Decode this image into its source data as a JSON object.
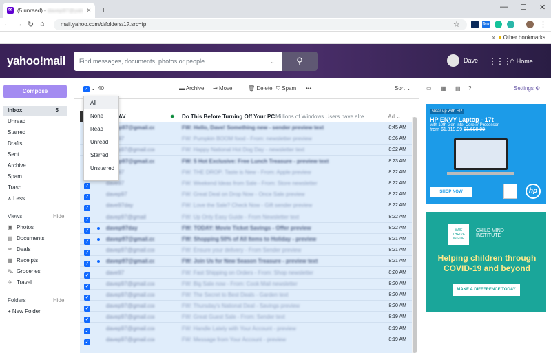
{
  "browser": {
    "tab_title": "(5 unread) - ",
    "tab_blur": "davep97@yahoo.com",
    "url": "mail.yahoo.com/d/folders/1?.src=fp",
    "bookmarks": "Other bookmarks",
    "ext_new": "New"
  },
  "header": {
    "logo": "yahoo!mail",
    "search_placeholder": "Find messages, documents, photos or people",
    "user": "Dave",
    "home": "Home"
  },
  "sidebar": {
    "compose": "Compose",
    "folders": [
      {
        "label": "Inbox",
        "count": "5"
      },
      {
        "label": "Unread"
      },
      {
        "label": "Starred"
      },
      {
        "label": "Drafts"
      },
      {
        "label": "Sent"
      },
      {
        "label": "Archive"
      },
      {
        "label": "Spam"
      },
      {
        "label": "Trash"
      },
      {
        "label": "∧ Less"
      }
    ],
    "views_label": "Views",
    "views_hide": "Hide",
    "views": [
      "Photos",
      "Documents",
      "Deals",
      "Receipts",
      "Groceries",
      "Travel"
    ],
    "folders_label": "Folders",
    "folders_hide": "Hide",
    "new_folder": "+ New Folder"
  },
  "toolbar": {
    "count": "40",
    "archive": "Archive",
    "move": "Move",
    "delete": "Delete",
    "spam": "Spam",
    "more": "•••",
    "sort": "Sort"
  },
  "select_menu": [
    "All",
    "None",
    "Read",
    "Unread",
    "Starred",
    "Unstarred"
  ],
  "ad_row": {
    "sender": "AV",
    "subject": "Do This Before Turning Off Your PC",
    "preview": "Millions of Windows Users have alre...",
    "tag": "Ad"
  },
  "rows": [
    {
      "sender": "davep97@gmail.com",
      "subject": "FW: Hello, Dave! Something new - sender preview text",
      "time": "8:45 AM",
      "bold": true
    },
    {
      "sender": "dave97",
      "subject": "FW: Pumpkin BOOM food - From: newsletter preview",
      "time": "8:36 AM",
      "bold": false
    },
    {
      "sender": "davep97@gmail.com",
      "subject": "FW: Happy National Hot Dog Day - newsletter text",
      "time": "8:32 AM",
      "bold": false
    },
    {
      "sender": "davep97@gmail.com",
      "subject": "FW: 5 Hot Exclusive: Free Lunch Treasure - preview text",
      "time": "8:23 AM",
      "bold": true
    },
    {
      "sender": "dave97",
      "subject": "FW: THE DROP: Taste is New - From: Apple preview",
      "time": "8:22 AM",
      "bold": false
    },
    {
      "sender": "dave97",
      "subject": "FW: Weekend Ideas from Sale - From: Store newsletter",
      "time": "8:22 AM",
      "bold": false
    },
    {
      "sender": "davep97",
      "subject": "FW: Great Deal on Drop Now - Once Sale preview",
      "time": "8:22 AM",
      "bold": false
    },
    {
      "sender": "dave97day",
      "subject": "FW: Love the Sale? Check Now - Gift sender preview",
      "time": "8:22 AM",
      "bold": false
    },
    {
      "sender": "davep97@gmail",
      "subject": "FW: Up Only Easy Guide - From Newsletter text",
      "time": "8:22 AM",
      "bold": false
    },
    {
      "sender": "davep97day",
      "subject": "FW: TODAY: Movie Ticket Savings - Offer preview",
      "time": "8:22 AM",
      "bold": true
    },
    {
      "sender": "davep97@gmail.com",
      "subject": "FW: Shopping 50% of All Items to Holiday - preview",
      "time": "8:21 AM",
      "bold": true
    },
    {
      "sender": "davep97@gmail.com",
      "subject": "FW: Ensure your delivery - From Sender preview",
      "time": "8:21 AM",
      "bold": false
    },
    {
      "sender": "davep97@gmail.com",
      "subject": "FW: Join Us for New Season Treasure - preview text",
      "time": "8:21 AM",
      "bold": true
    },
    {
      "sender": "dave97",
      "subject": "FW: Fast Shipping on Orders - From: Shop newsletter",
      "time": "8:20 AM",
      "bold": false
    },
    {
      "sender": "davep97@gmail.com",
      "subject": "FW: Big Sale now - From: Cook Mail newsletter",
      "time": "8:20 AM",
      "bold": false
    },
    {
      "sender": "davep97@gmail.com",
      "subject": "FW: The Secret to Best Deals - Garden text",
      "time": "8:20 AM",
      "bold": false
    },
    {
      "sender": "davep97@gmail.com",
      "subject": "FW: Thursday's National Deal - Savings preview",
      "time": "8:20 AM",
      "bold": false
    },
    {
      "sender": "davep97@gmail.com",
      "subject": "FW: Great Guest Sale - From: Sender text",
      "time": "8:19 AM",
      "bold": false
    },
    {
      "sender": "davep97@gmail.com",
      "subject": "FW: Handle Lately with Your Account - preview",
      "time": "8:19 AM",
      "bold": false
    },
    {
      "sender": "davep97@gmail.com",
      "subject": "FW: Message from Your Account - preview",
      "time": "8:19 AM",
      "bold": false
    }
  ],
  "right": {
    "settings": "Settings",
    "ad1": {
      "tag": "Gear up with HP",
      "title": "HP ENVY Laptop - 17t",
      "sub": "with 10th Gen Intel Core i7 Processor",
      "price": "from $1,319.99",
      "old": "$1,699.99",
      "cta": "SHOP NOW",
      "brand": "hp"
    },
    "ad2": {
      "badge": "#WE THRIVE INSIDE",
      "org": "CHILD MIND INSTITUTE",
      "headline": "Helping children through COVID-19 and beyond",
      "cta": "MAKE A DIFFERENCE TODAY"
    }
  }
}
